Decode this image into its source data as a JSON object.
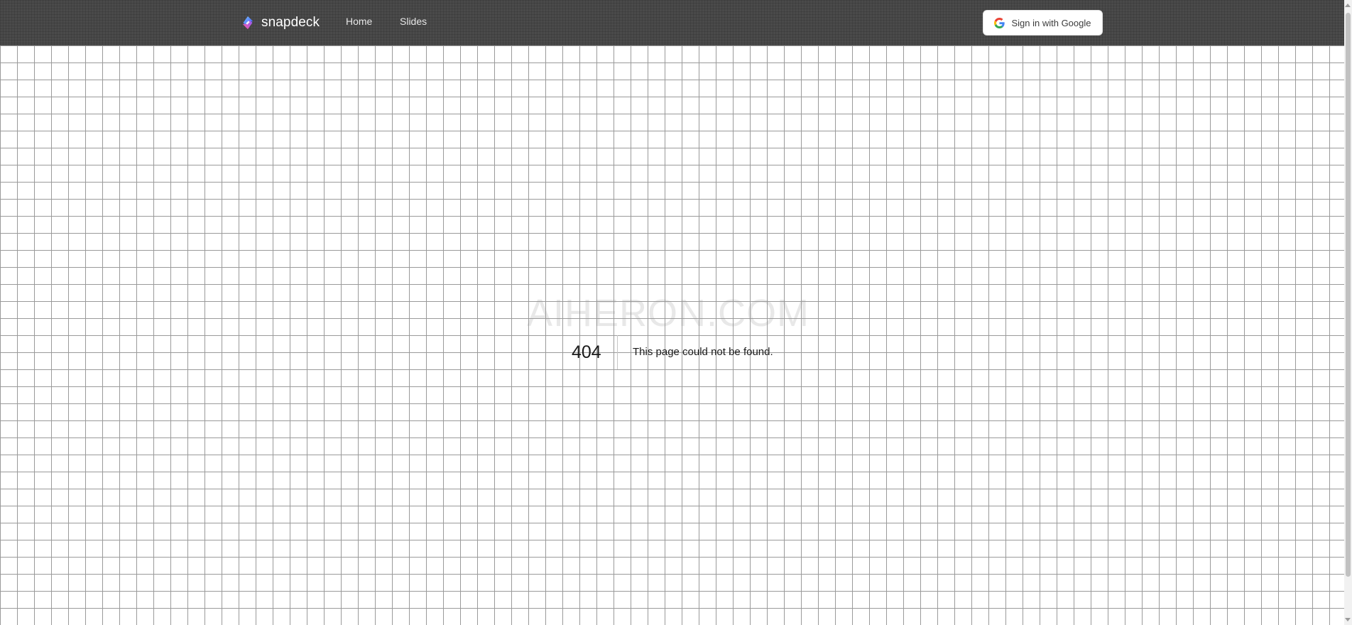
{
  "header": {
    "brand": "snapdeck",
    "nav": [
      {
        "label": "Home"
      },
      {
        "label": "Slides"
      }
    ],
    "signin_label": "Sign in with Google"
  },
  "main": {
    "watermark": "AIHERON.COM",
    "error_code": "404",
    "error_message": "This page could not be found."
  },
  "icons": {
    "brand_logo": "snapdeck-logo-icon",
    "google": "google-g-icon"
  },
  "colors": {
    "topbar": "#4a4a4a",
    "grid_line": "#9a9a9a",
    "button_bg": "#ffffff"
  }
}
